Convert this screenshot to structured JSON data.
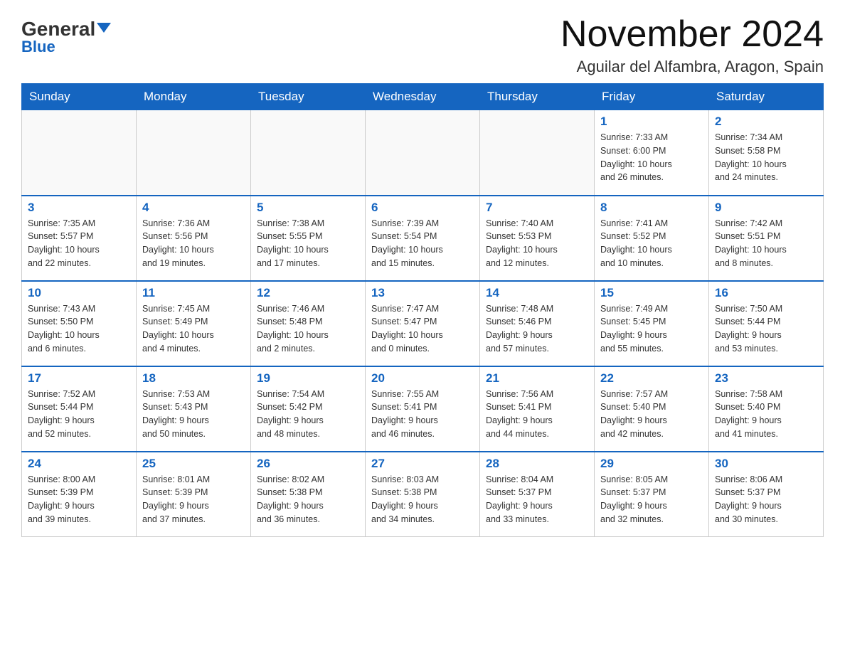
{
  "header": {
    "logo_general": "General",
    "logo_blue": "Blue",
    "month_title": "November 2024",
    "location": "Aguilar del Alfambra, Aragon, Spain"
  },
  "weekdays": [
    "Sunday",
    "Monday",
    "Tuesday",
    "Wednesday",
    "Thursday",
    "Friday",
    "Saturday"
  ],
  "weeks": [
    [
      {
        "day": "",
        "info": ""
      },
      {
        "day": "",
        "info": ""
      },
      {
        "day": "",
        "info": ""
      },
      {
        "day": "",
        "info": ""
      },
      {
        "day": "",
        "info": ""
      },
      {
        "day": "1",
        "info": "Sunrise: 7:33 AM\nSunset: 6:00 PM\nDaylight: 10 hours\nand 26 minutes."
      },
      {
        "day": "2",
        "info": "Sunrise: 7:34 AM\nSunset: 5:58 PM\nDaylight: 10 hours\nand 24 minutes."
      }
    ],
    [
      {
        "day": "3",
        "info": "Sunrise: 7:35 AM\nSunset: 5:57 PM\nDaylight: 10 hours\nand 22 minutes."
      },
      {
        "day": "4",
        "info": "Sunrise: 7:36 AM\nSunset: 5:56 PM\nDaylight: 10 hours\nand 19 minutes."
      },
      {
        "day": "5",
        "info": "Sunrise: 7:38 AM\nSunset: 5:55 PM\nDaylight: 10 hours\nand 17 minutes."
      },
      {
        "day": "6",
        "info": "Sunrise: 7:39 AM\nSunset: 5:54 PM\nDaylight: 10 hours\nand 15 minutes."
      },
      {
        "day": "7",
        "info": "Sunrise: 7:40 AM\nSunset: 5:53 PM\nDaylight: 10 hours\nand 12 minutes."
      },
      {
        "day": "8",
        "info": "Sunrise: 7:41 AM\nSunset: 5:52 PM\nDaylight: 10 hours\nand 10 minutes."
      },
      {
        "day": "9",
        "info": "Sunrise: 7:42 AM\nSunset: 5:51 PM\nDaylight: 10 hours\nand 8 minutes."
      }
    ],
    [
      {
        "day": "10",
        "info": "Sunrise: 7:43 AM\nSunset: 5:50 PM\nDaylight: 10 hours\nand 6 minutes."
      },
      {
        "day": "11",
        "info": "Sunrise: 7:45 AM\nSunset: 5:49 PM\nDaylight: 10 hours\nand 4 minutes."
      },
      {
        "day": "12",
        "info": "Sunrise: 7:46 AM\nSunset: 5:48 PM\nDaylight: 10 hours\nand 2 minutes."
      },
      {
        "day": "13",
        "info": "Sunrise: 7:47 AM\nSunset: 5:47 PM\nDaylight: 10 hours\nand 0 minutes."
      },
      {
        "day": "14",
        "info": "Sunrise: 7:48 AM\nSunset: 5:46 PM\nDaylight: 9 hours\nand 57 minutes."
      },
      {
        "day": "15",
        "info": "Sunrise: 7:49 AM\nSunset: 5:45 PM\nDaylight: 9 hours\nand 55 minutes."
      },
      {
        "day": "16",
        "info": "Sunrise: 7:50 AM\nSunset: 5:44 PM\nDaylight: 9 hours\nand 53 minutes."
      }
    ],
    [
      {
        "day": "17",
        "info": "Sunrise: 7:52 AM\nSunset: 5:44 PM\nDaylight: 9 hours\nand 52 minutes."
      },
      {
        "day": "18",
        "info": "Sunrise: 7:53 AM\nSunset: 5:43 PM\nDaylight: 9 hours\nand 50 minutes."
      },
      {
        "day": "19",
        "info": "Sunrise: 7:54 AM\nSunset: 5:42 PM\nDaylight: 9 hours\nand 48 minutes."
      },
      {
        "day": "20",
        "info": "Sunrise: 7:55 AM\nSunset: 5:41 PM\nDaylight: 9 hours\nand 46 minutes."
      },
      {
        "day": "21",
        "info": "Sunrise: 7:56 AM\nSunset: 5:41 PM\nDaylight: 9 hours\nand 44 minutes."
      },
      {
        "day": "22",
        "info": "Sunrise: 7:57 AM\nSunset: 5:40 PM\nDaylight: 9 hours\nand 42 minutes."
      },
      {
        "day": "23",
        "info": "Sunrise: 7:58 AM\nSunset: 5:40 PM\nDaylight: 9 hours\nand 41 minutes."
      }
    ],
    [
      {
        "day": "24",
        "info": "Sunrise: 8:00 AM\nSunset: 5:39 PM\nDaylight: 9 hours\nand 39 minutes."
      },
      {
        "day": "25",
        "info": "Sunrise: 8:01 AM\nSunset: 5:39 PM\nDaylight: 9 hours\nand 37 minutes."
      },
      {
        "day": "26",
        "info": "Sunrise: 8:02 AM\nSunset: 5:38 PM\nDaylight: 9 hours\nand 36 minutes."
      },
      {
        "day": "27",
        "info": "Sunrise: 8:03 AM\nSunset: 5:38 PM\nDaylight: 9 hours\nand 34 minutes."
      },
      {
        "day": "28",
        "info": "Sunrise: 8:04 AM\nSunset: 5:37 PM\nDaylight: 9 hours\nand 33 minutes."
      },
      {
        "day": "29",
        "info": "Sunrise: 8:05 AM\nSunset: 5:37 PM\nDaylight: 9 hours\nand 32 minutes."
      },
      {
        "day": "30",
        "info": "Sunrise: 8:06 AM\nSunset: 5:37 PM\nDaylight: 9 hours\nand 30 minutes."
      }
    ]
  ]
}
